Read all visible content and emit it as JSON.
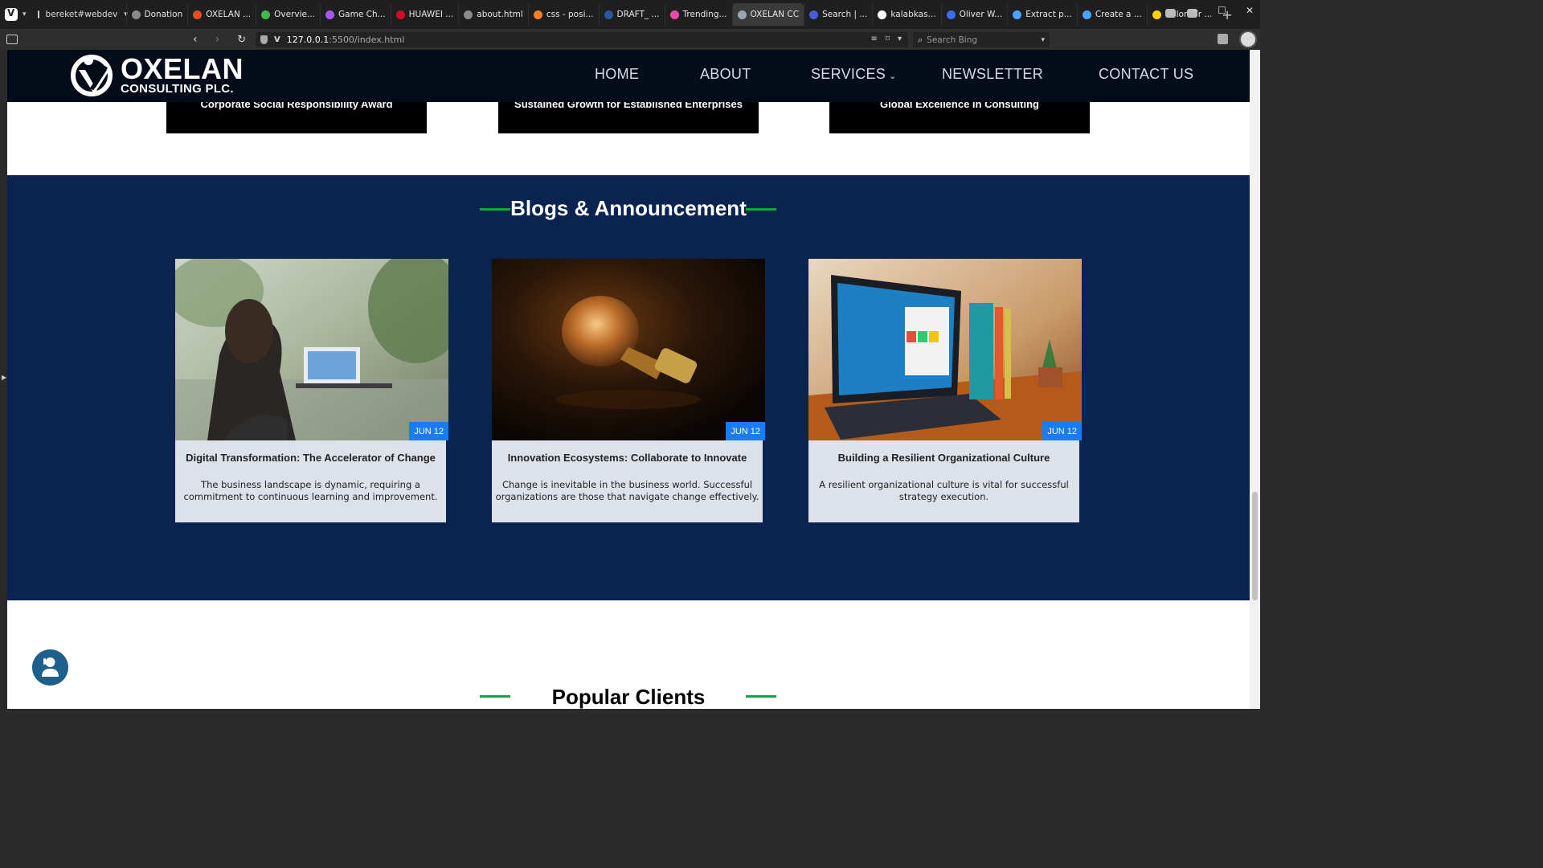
{
  "browser": {
    "workspace": "bereket#webdev",
    "tabs": [
      {
        "label": "Donation",
        "color": "#8a8a8a"
      },
      {
        "label": "OXELAN ...",
        "color": "#e44d26"
      },
      {
        "label": "Overvie...",
        "color": "#3fb950"
      },
      {
        "label": "Game Ch...",
        "color": "#a259ff"
      },
      {
        "label": "HUAWEI ...",
        "color": "#cf0a2c"
      },
      {
        "label": "about.html",
        "color": "#8a8a8a"
      },
      {
        "label": "css - posi...",
        "color": "#f48024"
      },
      {
        "label": "DRAFT_ ...",
        "color": "#2b579a"
      },
      {
        "label": "Trending...",
        "color": "#ea4aaa"
      },
      {
        "label": "OXELAN CC",
        "color": "#9aa4b2",
        "active": true
      },
      {
        "label": "Search | ...",
        "color": "#4b5bd6"
      },
      {
        "label": "kalabkas...",
        "color": "#ffffff"
      },
      {
        "label": "Oliver W...",
        "color": "#3a6df0"
      },
      {
        "label": "Extract p...",
        "color": "#4aa3ff"
      },
      {
        "label": "Create a ...",
        "color": "#4aa3ff"
      },
      {
        "label": "Color for ...",
        "color": "#ffd200"
      }
    ],
    "url_host": "127.0.0.1",
    "url_path": ":5500/index.html",
    "search_placeholder": "Search Bing"
  },
  "site": {
    "logo": {
      "title": "OXELAN",
      "subtitle": "CONSULTING PLC."
    },
    "nav": {
      "home": "HOME",
      "about": "ABOUT",
      "services": "SERVICES",
      "newsletter": "NEWSLETTER",
      "contact": "CONTACT US"
    },
    "awards": [
      "Corporate Social Responsibility Award",
      "Sustained Growth for Established Enterprises",
      "Global Excellence in Consulting"
    ],
    "blogs": {
      "title": "Blogs & Announcement",
      "posts": [
        {
          "date": "JUN 12",
          "title": "Digital Transformation: The Accelerator of Change",
          "excerpt": "The business landscape is dynamic, requiring a commitment to continuous learning and improvement."
        },
        {
          "date": "JUN 12",
          "title": "Innovation Ecosystems: Collaborate to Innovate",
          "excerpt": "Change is inevitable in the business world. Successful organizations are those that navigate change effectively."
        },
        {
          "date": "JUN 12",
          "title": "Building a Resilient Organizational Culture",
          "excerpt": "A resilient organizational culture is vital for successful strategy execution."
        }
      ]
    },
    "clients": {
      "title": "Popular Clients"
    }
  },
  "colors": {
    "header_bg": "#040c1a",
    "blogs_bg": "#0b2350",
    "accent_green": "#17a244",
    "badge_blue": "#1a7cf5",
    "card_body": "#dde1ea"
  }
}
